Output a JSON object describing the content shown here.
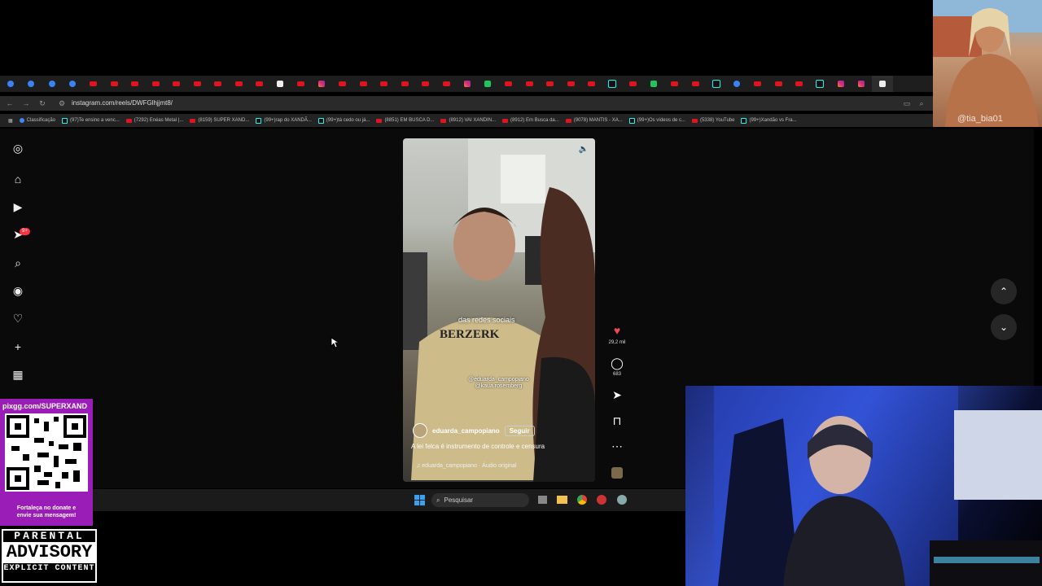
{
  "browser": {
    "url": "instagram.com/reels/DWFGlhjjmt8/",
    "tabs_count": 43,
    "bookmarks": [
      {
        "label": "Classificação",
        "icon": "globe-icon"
      },
      {
        "label": "(97)Te ensino a venc...",
        "icon": "tiktok-icon"
      },
      {
        "label": "(7292) Enéas Metal |...",
        "icon": "youtube-icon"
      },
      {
        "label": "(8159) SUPER XAND...",
        "icon": "youtube-icon"
      },
      {
        "label": "(99+)rap do XANDÃ...",
        "icon": "tiktok-icon"
      },
      {
        "label": "(99+)tá cedo ou já...",
        "icon": "tiktok-icon"
      },
      {
        "label": "(8851) EM BUSCA D...",
        "icon": "youtube-icon"
      },
      {
        "label": "(8912) VAI XANDIN...",
        "icon": "youtube-icon"
      },
      {
        "label": "(8912) Em Busca da...",
        "icon": "youtube-icon"
      },
      {
        "label": "(9078) MANTIS - XA...",
        "icon": "youtube-icon"
      },
      {
        "label": "(99+)Os vídeos de c...",
        "icon": "tiktok-icon"
      },
      {
        "label": "(5338) YouTube",
        "icon": "youtube-icon"
      },
      {
        "label": "(99+)Xandão vs Fra...",
        "icon": "tiktok-icon"
      }
    ]
  },
  "instagram": {
    "sidebar": [
      {
        "name": "instagram-logo-icon",
        "glyph": "◎"
      },
      {
        "name": "home-icon",
        "glyph": "⌂"
      },
      {
        "name": "reels-icon",
        "glyph": "▶"
      },
      {
        "name": "messages-icon",
        "glyph": "➤"
      },
      {
        "name": "search-icon",
        "glyph": "⌕"
      },
      {
        "name": "explore-icon",
        "glyph": "◉"
      },
      {
        "name": "notifications-icon",
        "glyph": "♡"
      },
      {
        "name": "create-icon",
        "glyph": "+"
      },
      {
        "name": "dashboard-icon",
        "glyph": "▦"
      }
    ],
    "messages_badge": "9+",
    "reel": {
      "overlay_caption": "das redes sociais",
      "tag1": "@eduarda_campopiano",
      "tag2": "@kaua.rosemberg",
      "username": "eduarda_campopiano",
      "follow_label": "Seguir",
      "caption": "A lei felca é instrumento de controle e censura",
      "audio": "eduarda_campopiano · Áudio original",
      "likes": "29,2 mil",
      "comments": "683"
    }
  },
  "taskbar": {
    "search_placeholder": "Pesquisar"
  },
  "overlays": {
    "top_cam_watermark": "@tia_bia01",
    "pix_key": "pixgg.com/SUPERXAND",
    "pix_message_line1": "Fortaleça no donate e",
    "pix_message_line2": "envie sua mensagem!",
    "advisory_line1": "PARENTAL",
    "advisory_line2": "ADVISORY",
    "advisory_line3": "EXPLICIT CONTENT"
  },
  "colors": {
    "like_red": "#ed4956",
    "youtube_red": "#e0141e",
    "pix_purple": "#9b1db8"
  }
}
